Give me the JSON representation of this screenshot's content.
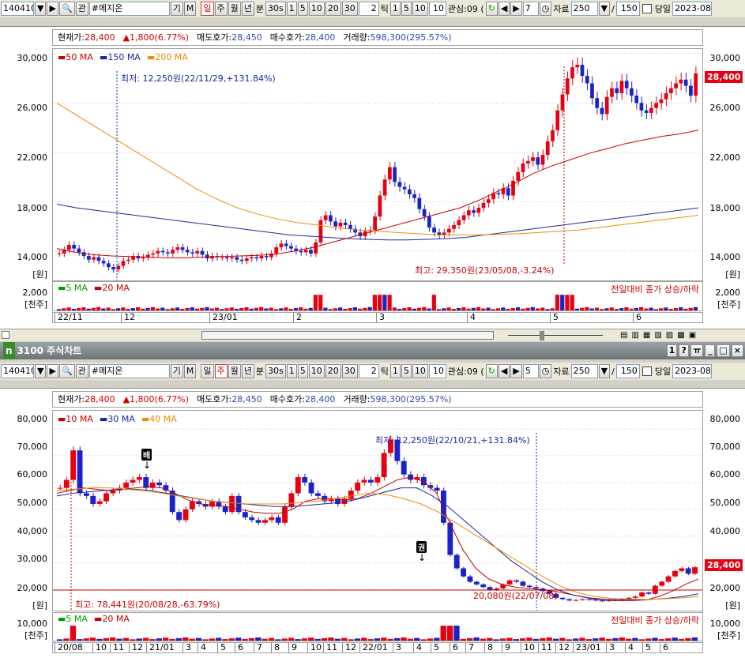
{
  "toolbar_top": {
    "code": "140410",
    "search_icon": "Q",
    "gwan": "관",
    "name": "#메지온",
    "gi": "기",
    "m": "M",
    "periods": [
      "일",
      "주",
      "월",
      "년"
    ],
    "bun_label": "분",
    "min_opts": [
      "30s",
      "1",
      "5",
      "10",
      "20",
      "30"
    ],
    "tick_val": "2",
    "tick_label": "틱",
    "tick_opts": [
      "1",
      "5",
      "10"
    ],
    "n_val": "10",
    "gwansim": "관심:09 (",
    "num": "7",
    "jaryo_label": "자료",
    "jaryo_val": "250",
    "slash": "/",
    "total": "150",
    "dangil": "당일",
    "date": "2023-08"
  },
  "toolbar_bottom": {
    "num": "5",
    "date": "2023-08"
  },
  "window_title": "3100 주식차트",
  "info": {
    "cur_label": "현재가:",
    "cur_val": "28,400",
    "chg": "▲1,800(6.77%)",
    "ask_label": "매도호가:",
    "ask_val": "28,450",
    "bid_label": "매수호가:",
    "bid_val": "28,400",
    "vol_label": "거래량:",
    "vol_val": "598,300(295.57%)"
  },
  "colors": {
    "up": "#e60012",
    "down": "#1a23c8",
    "ma50": "#c80000",
    "ma150": "#1a2a9c",
    "ma200": "#f08c00",
    "ma5": "#00a000",
    "grid": "#cccccc"
  },
  "chart_data": [
    {
      "type": "line",
      "title": "일봉",
      "legend": [
        "50 MA",
        "150 MA",
        "200 MA"
      ],
      "ylim": [
        12000,
        30000
      ],
      "yticks": [
        "30,000",
        "26,000",
        "22,000",
        "18,000",
        "14,000"
      ],
      "yunit": "[원]",
      "xticks": [
        "22/11",
        "12",
        "23/01",
        "2",
        "3",
        "4",
        "5",
        "6"
      ],
      "annotations": [
        "최저: 12,250원(22/11/29,+131.84%)",
        "최고: 29,350원(23/05/08,-3.24%)"
      ],
      "last_price": "28,400",
      "series": [
        {
          "name": "Close",
          "values": [
            13800,
            14100,
            14500,
            14200,
            13900,
            13600,
            13300,
            13500,
            13200,
            13000,
            12700,
            12500,
            12800,
            13200,
            13300,
            13600,
            13400,
            13500,
            13700,
            13800,
            14000,
            13900,
            13800,
            14100,
            14300,
            14100,
            13900,
            13800,
            14000,
            13700,
            13400,
            13600,
            13500,
            13500,
            13400,
            13500,
            13300,
            13200,
            13400,
            13500,
            13400,
            13600,
            13500,
            13800,
            14300,
            14600,
            14400,
            14200,
            14000,
            13900,
            14100,
            13800,
            14700,
            16500,
            16900,
            16400,
            16000,
            16300,
            16100,
            15800,
            15500,
            15200,
            15600,
            15700,
            16800,
            18500,
            19800,
            20800,
            19600,
            19200,
            19000,
            18600,
            18300,
            17400,
            16800,
            15900,
            15500,
            15300,
            15500,
            15800,
            16100,
            16500,
            16900,
            17300,
            17100,
            17500,
            17900,
            18200,
            18700,
            18600,
            19100,
            18500,
            19700,
            20400,
            21100,
            21300,
            21600,
            21000,
            21800,
            22900,
            23800,
            25400,
            26700,
            28000,
            28900,
            29100,
            28200,
            27600,
            26400,
            25600,
            25100,
            26500,
            27200,
            26800,
            27800,
            27200,
            26600,
            26000,
            25400,
            25200,
            25600,
            26000,
            26300,
            26800,
            27200,
            27600,
            27900,
            27400,
            26600,
            28400
          ]
        },
        {
          "name": "50 MA",
          "values": [
            14200,
            13900,
            13700,
            13600,
            13550,
            13500,
            13450,
            13450,
            13500,
            13550,
            13600,
            13650,
            13750,
            14000,
            14300,
            14700,
            15100,
            15500,
            15900,
            16300,
            16700,
            17100,
            17500,
            18100,
            18800,
            19500,
            20300,
            20900,
            21400,
            21900,
            22300,
            22700,
            23000,
            23300,
            23500,
            23800
          ]
        },
        {
          "name": "150 MA",
          "values": [
            17800,
            17500,
            17300,
            17100,
            16900,
            16700,
            16500,
            16300,
            16100,
            15900,
            15700,
            15500,
            15300,
            15200,
            15100,
            15000,
            14950,
            14900,
            14900,
            14950,
            15000,
            15100,
            15300,
            15500,
            15700,
            15900,
            16100,
            16300,
            16500,
            16700,
            16900,
            17100,
            17300,
            17500
          ]
        },
        {
          "name": "200 MA",
          "values": [
            26000,
            25000,
            24000,
            23000,
            22000,
            21000,
            20000,
            19000,
            18200,
            17500,
            17000,
            16600,
            16300,
            16100,
            15900,
            15700,
            15600,
            15500,
            15400,
            15300,
            15300,
            15300,
            15350,
            15400,
            15500,
            15600,
            15700,
            15900,
            16100,
            16300,
            16500,
            16700,
            16900
          ]
        }
      ]
    },
    {
      "type": "line",
      "title": "주봉",
      "legend": [
        "10 MA",
        "30 MA",
        "40 MA"
      ],
      "ylim": [
        14000,
        85000
      ],
      "yticks": [
        "80,000",
        "70,000",
        "60,000",
        "50,000",
        "40,000",
        "30,000",
        "20,000"
      ],
      "yunit": "[원]",
      "xticks": [
        "20/08",
        "10",
        "11",
        "12",
        "21/01",
        "3",
        "4",
        "5",
        "6",
        "7",
        "8",
        "9",
        "10",
        "11",
        "12",
        "22/01",
        "3",
        "4",
        "5",
        "6",
        "7",
        "8",
        "9",
        "10",
        "11",
        "12",
        "23/01",
        "3",
        "4",
        "5",
        "6"
      ],
      "annotations": [
        "최저: 12,250원(22/10/21,+131.84%)",
        "최고: 78,441원(20/08/28,-63.79%)",
        "20,080원(22/07/08)"
      ],
      "markers": [
        "배",
        "권"
      ],
      "last_price": "28,400",
      "series": [
        {
          "name": "Close",
          "values": [
            58000,
            61000,
            72000,
            56000,
            55000,
            52000,
            53000,
            56000,
            57000,
            58000,
            60000,
            61000,
            62000,
            58000,
            60000,
            59000,
            57000,
            49000,
            46000,
            50000,
            53000,
            52000,
            51000,
            53000,
            51000,
            49000,
            55000,
            49000,
            47000,
            46000,
            45000,
            46000,
            47000,
            45000,
            51000,
            56000,
            62000,
            60000,
            56000,
            55000,
            53000,
            54000,
            52000,
            54000,
            57000,
            60000,
            61000,
            60000,
            62000,
            71000,
            76000,
            68000,
            63000,
            61000,
            62000,
            59000,
            58000,
            57000,
            45000,
            33000,
            28000,
            25000,
            23000,
            22000,
            21000,
            20000,
            20500,
            22000,
            23500,
            23000,
            21500,
            21000,
            20500,
            19500,
            18500,
            17000,
            16500,
            16000,
            16200,
            16500,
            16300,
            16000,
            15800,
            16200,
            16000,
            16500,
            17000,
            17500,
            19000,
            18500,
            21500,
            23000,
            25000,
            27000,
            28000,
            26000,
            28400
          ]
        },
        {
          "name": "10 MA",
          "values": [
            56000,
            57000,
            58000,
            57500,
            57000,
            57500,
            58000,
            58500,
            58000,
            56000,
            53500,
            52000,
            51500,
            51000,
            50000,
            49000,
            48500,
            48500,
            50000,
            53000,
            54000,
            54000,
            53500,
            54000,
            56000,
            58500,
            61000,
            62000,
            60500,
            56000,
            45000,
            35000,
            28000,
            24000,
            22000,
            21000,
            20500,
            20000,
            19500,
            18500,
            17500,
            16500,
            16000,
            16000,
            16000,
            16200,
            17500,
            19500,
            22000,
            24000
          ]
        },
        {
          "name": "30 MA",
          "values": [
            55000,
            56000,
            56500,
            57000,
            57500,
            57500,
            57000,
            56000,
            55000,
            54000,
            53000,
            52500,
            52000,
            51500,
            51000,
            51000,
            51500,
            52000,
            52500,
            53500,
            55000,
            56500,
            58000,
            58000,
            55000,
            51000,
            46000,
            41000,
            36000,
            31000,
            27000,
            23000,
            20000,
            18000,
            17000,
            16500,
            16200,
            16200,
            16400,
            16800,
            17500,
            18500
          ]
        },
        {
          "name": "40 MA",
          "values": [
            57000,
            57500,
            58000,
            58000,
            57500,
            57000,
            56000,
            55000,
            54000,
            53000,
            52500,
            52000,
            52000,
            52000,
            52500,
            53000,
            54000,
            55000,
            56000,
            55500,
            54000,
            52000,
            49000,
            45000,
            41000,
            37000,
            33000,
            29000,
            25000,
            21500,
            19000,
            17500,
            16800,
            16500,
            16400,
            16600,
            17000,
            17500
          ]
        }
      ]
    }
  ],
  "volume": {
    "legend": [
      "5 MA",
      "20 MA"
    ],
    "right_text": "전일대비 종가 상승/하락",
    "top_ytick": "2,000",
    "unit": "[천주]",
    "bottom_ytick": "10,000"
  },
  "right_y_top": [
    "30,000",
    "26,000",
    "22,000",
    "18,000",
    "14,000"
  ],
  "right_y_bottom": [
    "80,000",
    "70,000",
    "60,000",
    "50,000",
    "40,000",
    "30,000",
    "20,000"
  ],
  "title_buttons": [
    "1",
    "?",
    "ㅠ",
    "?"
  ]
}
